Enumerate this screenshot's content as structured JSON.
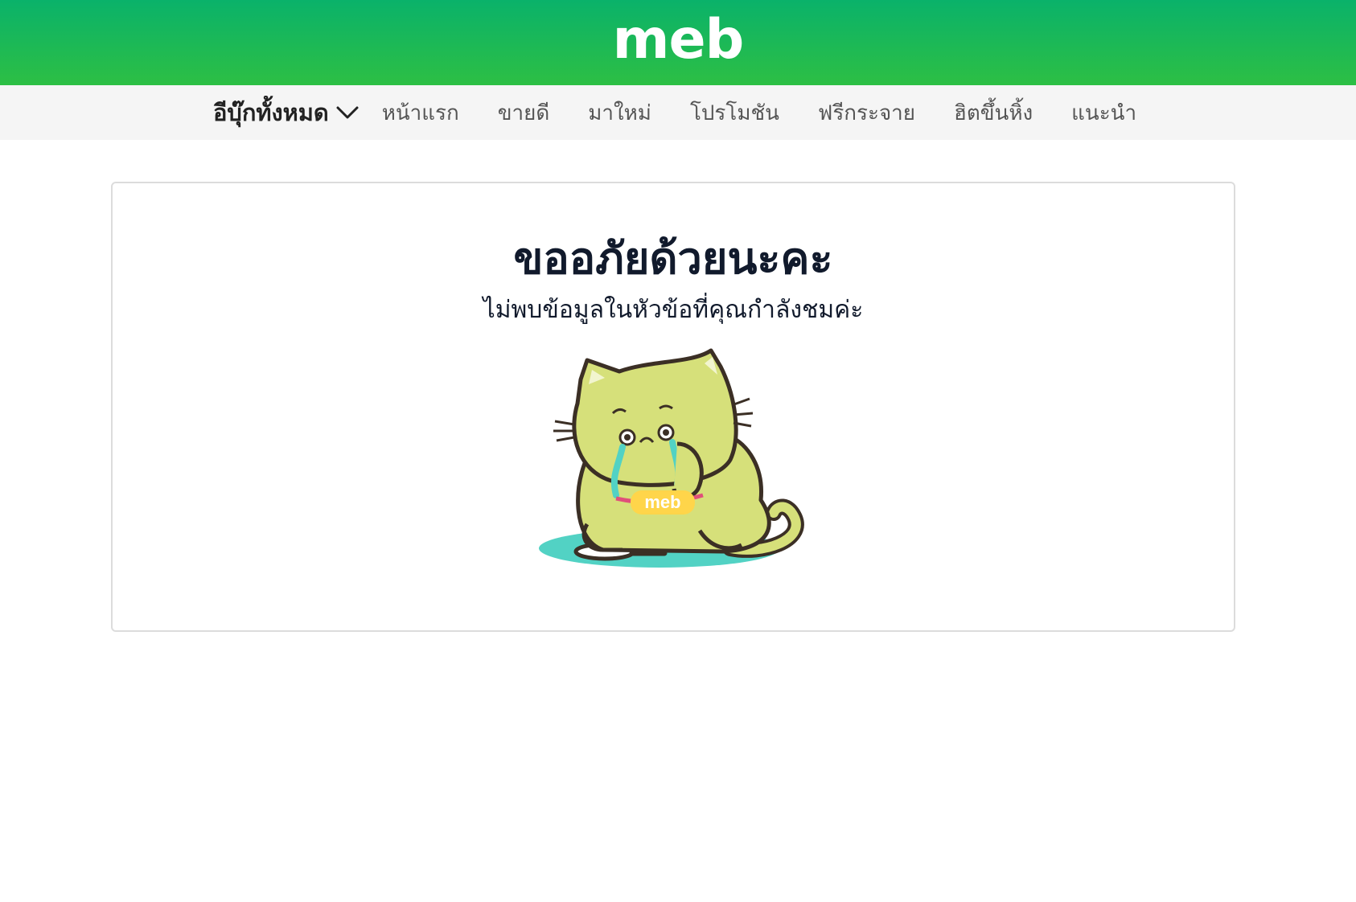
{
  "header": {
    "logo_text": "meb",
    "gradient_top": "#0ab26a",
    "gradient_bottom": "#2dbf44"
  },
  "nav": {
    "all_books_label": "อีบุ๊กทั้งหมด",
    "dropdown_icon": "chevron-down-icon",
    "items": [
      {
        "label": "หน้าแรก"
      },
      {
        "label": "ขายดี"
      },
      {
        "label": "มาใหม่"
      },
      {
        "label": "โปรโมชัน"
      },
      {
        "label": "ฟรีกระจาย"
      },
      {
        "label": "ฮิตขึ้นหิ้ง"
      },
      {
        "label": "แนะนำ"
      }
    ]
  },
  "error": {
    "title": "ขออภัยด้วยนะคะ",
    "message": "ไม่พบข้อมูลในหัวข้อที่คุณกำลังชมค่ะ",
    "illustration": "crying-cat-mascot",
    "illustration_text": "meb"
  }
}
